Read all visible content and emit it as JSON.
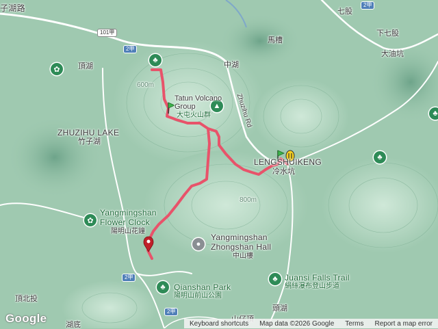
{
  "colors": {
    "trail": "#e8536a",
    "terrain": "#9fc9b0",
    "park": "#2e8b57",
    "road": "#ffffff",
    "water": "#7fa8c9"
  },
  "labels": {
    "zihu_road": "子湖路",
    "t7": "七股",
    "mazao": "馬槽",
    "xiaqigu": "下七股",
    "dayoukeng": "大油坑",
    "dinghu": "頂湖",
    "zhonghu": "中湖",
    "tatun_en": "Tatun Volcano Group",
    "tatun_zh": "大屯火山群",
    "zhuzihu_en": "ZHUZIHU LAKE",
    "zhuzihu_zh": "竹子湖",
    "lengshuikeng_en": "LENGSHUIKENG",
    "lengshuikeng_zh": "冷水坑",
    "zhuzihu_rd": "Zhuzihu Rd",
    "ymsflower_en": "Yangmingshan Flower Clock",
    "ymsflower_zh": "陽明山花鐘",
    "zhongshan_en": "Yangmingshan Zhongshan Hall",
    "zhongshan_zh": "中山樓",
    "qianshan_en": "Qianshan Park",
    "qianshan_zh": "陽明山前山公園",
    "juansi_en": "Juansi Falls Trail",
    "juansi_zh": "絹絲瀑布登山步道",
    "dinghu2": "頂湖",
    "touhu": "頭湖",
    "dingbeitou": "頂北投",
    "hudi": "湖底",
    "shanzi": "山仔頂",
    "hwy2": "2甲",
    "hwy101": "101甲",
    "elev600": "600m",
    "elev800": "800m"
  },
  "footer": {
    "shortcuts": "Keyboard shortcuts",
    "mapdata": "Map data ©2026 Google",
    "terms": "Terms",
    "report": "Report a map error"
  },
  "logo": "Google"
}
